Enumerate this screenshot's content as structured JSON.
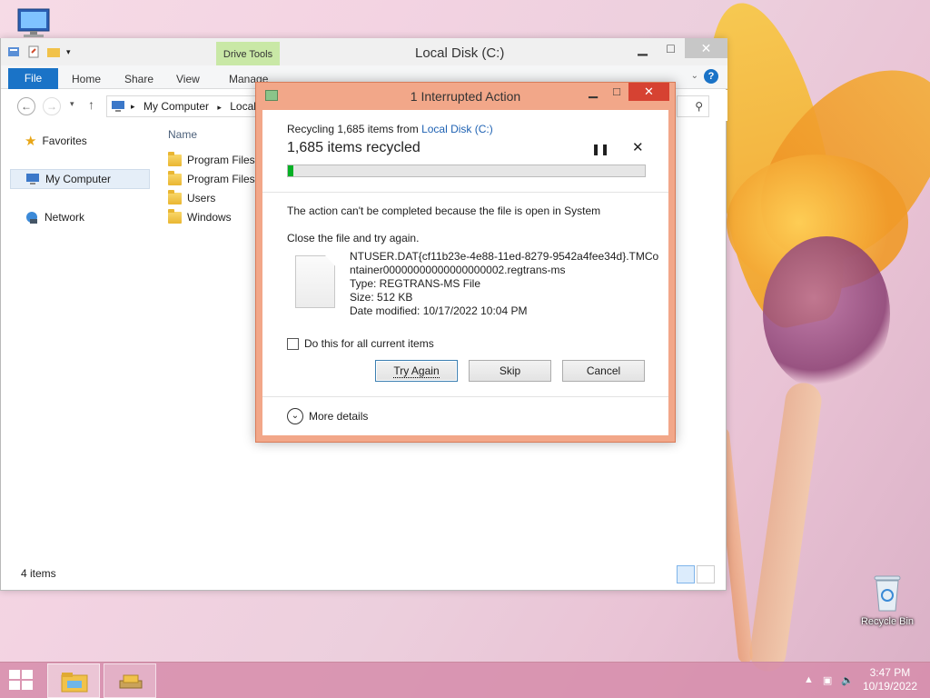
{
  "desktop": {
    "recycle_bin_label": "Recycle Bin"
  },
  "explorer": {
    "title": "Local Disk (C:)",
    "contextual_tab_group": "Drive Tools",
    "ribbon_tabs": [
      "File",
      "Home",
      "Share",
      "View",
      "Manage"
    ],
    "address": {
      "crumb1": "My Computer",
      "crumb2": "Local"
    },
    "nav": {
      "favorites": "Favorites",
      "my_computer": "My Computer",
      "network": "Network"
    },
    "column_header": "Name",
    "files": [
      "Program Files",
      "Program Files",
      "Users",
      "Windows"
    ],
    "status_count": "4 items"
  },
  "dialog": {
    "title": "1 Interrupted Action",
    "recycling_prefix": "Recycling 1,685 items from ",
    "recycling_source": "Local Disk (C:)",
    "items_recycled": "1,685 items recycled",
    "progress_percent": 1.5,
    "message_line1": "The action can't be completed because the file is open in System",
    "message_line2": "Close the file and try again.",
    "file": {
      "name_line1": "NTUSER.DAT{cf11b23e-4e88-11ed-8279-9542a4fee34d}.TMCo",
      "name_line2": "ntainer00000000000000000002.regtrans-ms",
      "type": "Type: REGTRANS-MS File",
      "size": "Size: 512 KB",
      "date_modified": "Date modified: 10/17/2022 10:04 PM"
    },
    "checkbox_label": "Do this for all current items",
    "buttons": {
      "try_again": "Try Again",
      "skip": "Skip",
      "cancel": "Cancel"
    },
    "more_details": "More details"
  },
  "taskbar": {
    "time": "3:47 PM",
    "date": "10/19/2022"
  },
  "colors": {
    "dialog_frame": "#f2a789",
    "progress_fill": "#06b025",
    "file_tab": "#1a73c7",
    "drive_tools": "#c9e8a6",
    "link": "#1f62b3"
  }
}
